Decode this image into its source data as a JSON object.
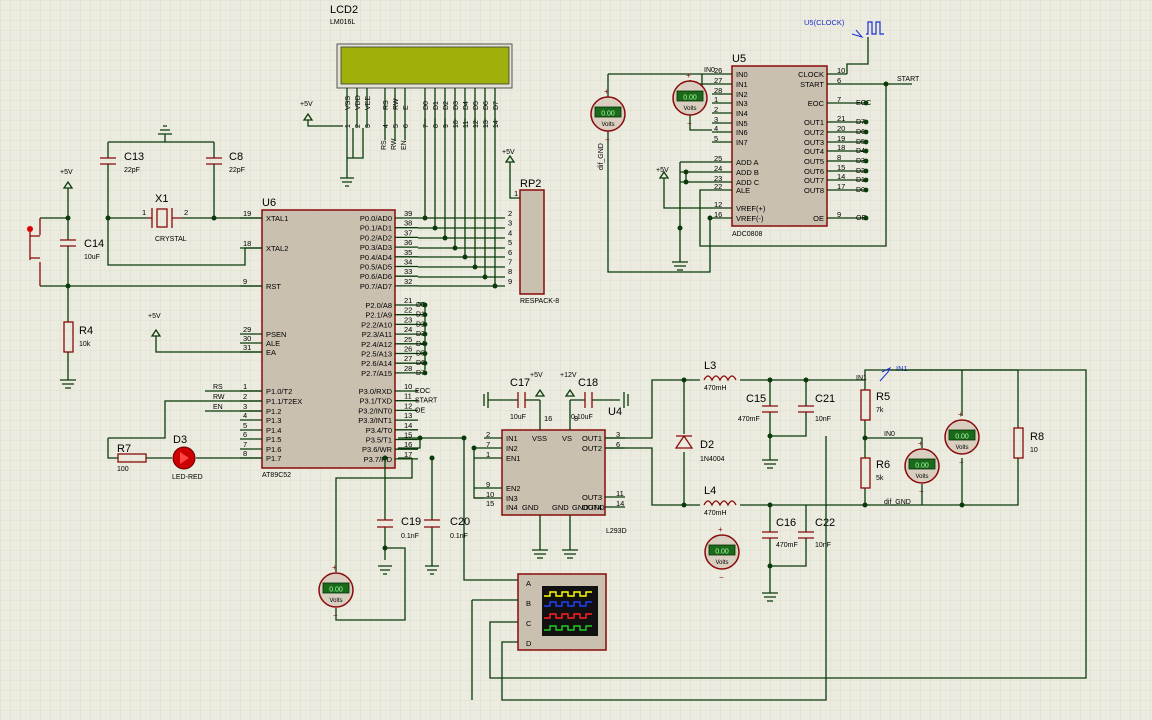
{
  "colors": {
    "background": "#ebebdf",
    "grid": "#d8d8c8",
    "wire": "#0a3a0a",
    "component": "#8a0a0a",
    "body": "#c9c0b0",
    "lcd": "#9fb00b",
    "meter": "#1a6a1a"
  },
  "lcd2": {
    "ref": "LCD2",
    "part": "LM016L",
    "pins": [
      "VSS",
      "VDD",
      "VEE",
      "RS",
      "RW",
      "E",
      "D0",
      "D1",
      "D2",
      "D3",
      "D4",
      "D5",
      "D6",
      "D7"
    ],
    "nums": [
      "1",
      "2",
      "3",
      "4",
      "5",
      "6",
      "7",
      "8",
      "9",
      "10",
      "11",
      "12",
      "13",
      "14"
    ],
    "rs": "RS",
    "rw": "RW",
    "en": "EN"
  },
  "u6": {
    "ref": "U6",
    "part": "AT89C52",
    "left": [
      {
        "n": "19",
        "l": "XTAL1"
      },
      {
        "n": "18",
        "l": "XTAL2"
      },
      {
        "n": "9",
        "l": "RST"
      },
      {
        "n": "29",
        "l": "PSEN"
      },
      {
        "n": "30",
        "l": "ALE"
      },
      {
        "n": "31",
        "l": "EA"
      },
      {
        "n": "1",
        "l": "P1.0/T2"
      },
      {
        "n": "2",
        "l": "P1.1/T2EX"
      },
      {
        "n": "3",
        "l": "P1.2"
      },
      {
        "n": "4",
        "l": "P1.3"
      },
      {
        "n": "5",
        "l": "P1.4"
      },
      {
        "n": "6",
        "l": "P1.5"
      },
      {
        "n": "7",
        "l": "P1.6"
      },
      {
        "n": "8",
        "l": "P1.7"
      }
    ],
    "p0": [
      {
        "n": "39",
        "l": "P0.0/AD0"
      },
      {
        "n": "38",
        "l": "P0.1/AD1"
      },
      {
        "n": "37",
        "l": "P0.2/AD2"
      },
      {
        "n": "36",
        "l": "P0.3/AD3"
      },
      {
        "n": "35",
        "l": "P0.4/AD4"
      },
      {
        "n": "34",
        "l": "P0.5/AD5"
      },
      {
        "n": "33",
        "l": "P0.6/AD6"
      },
      {
        "n": "32",
        "l": "P0.7/AD7"
      }
    ],
    "p2": [
      {
        "n": "21",
        "l": "P2.0/A8",
        "t": "D0"
      },
      {
        "n": "22",
        "l": "P2.1/A9",
        "t": "D1"
      },
      {
        "n": "23",
        "l": "P2.2/A10",
        "t": "D2"
      },
      {
        "n": "24",
        "l": "P2.3/A11",
        "t": "D3"
      },
      {
        "n": "25",
        "l": "P2.4/A12",
        "t": "D4"
      },
      {
        "n": "26",
        "l": "P2.5/A13",
        "t": "D5"
      },
      {
        "n": "27",
        "l": "P2.6/A14",
        "t": "D6"
      },
      {
        "n": "28",
        "l": "P2.7/A15",
        "t": "D7"
      }
    ],
    "p3": [
      {
        "n": "10",
        "l": "P3.0/RXD",
        "t": "EOC"
      },
      {
        "n": "11",
        "l": "P3.1/TXD",
        "t": "START"
      },
      {
        "n": "12",
        "l": "P3.2/INT0",
        "t": "OE"
      },
      {
        "n": "13",
        "l": "P3.3/INT1",
        "t": ""
      },
      {
        "n": "14",
        "l": "P3.4/T0",
        "t": ""
      },
      {
        "n": "15",
        "l": "P3.5/T1",
        "t": ""
      },
      {
        "n": "16",
        "l": "P3.6/WR",
        "t": ""
      },
      {
        "n": "17",
        "l": "P3.7/RD",
        "t": ""
      }
    ],
    "p1tags": [
      "RS",
      "RW",
      "EN"
    ]
  },
  "rp2": {
    "ref": "RP2",
    "part": "RESPACK-8",
    "pins": [
      "2",
      "3",
      "4",
      "5",
      "6",
      "7",
      "8",
      "9"
    ],
    "pin1": "1",
    "vcc": "+5V"
  },
  "u5": {
    "ref": "U5",
    "part": "ADC0808",
    "left": [
      {
        "n": "26",
        "l": "IN0"
      },
      {
        "n": "27",
        "l": "IN1"
      },
      {
        "n": "28",
        "l": "IN2"
      },
      {
        "n": "1",
        "l": "IN3"
      },
      {
        "n": "2",
        "l": "IN4"
      },
      {
        "n": "3",
        "l": "IN5"
      },
      {
        "n": "4",
        "l": "IN6"
      },
      {
        "n": "5",
        "l": "IN7"
      },
      {
        "n": "25",
        "l": "ADD A"
      },
      {
        "n": "24",
        "l": "ADD B"
      },
      {
        "n": "23",
        "l": "ADD C"
      },
      {
        "n": "22",
        "l": "ALE"
      },
      {
        "n": "12",
        "l": "VREF(+)"
      },
      {
        "n": "16",
        "l": "VREF(-)"
      }
    ],
    "right": [
      {
        "n": "10",
        "l": "CLOCK",
        "t": ""
      },
      {
        "n": "6",
        "l": "START",
        "t": ""
      },
      {
        "n": "7",
        "l": "EOC",
        "t": "EOC"
      },
      {
        "n": "21",
        "l": "OUT1",
        "t": "D7"
      },
      {
        "n": "20",
        "l": "OUT2",
        "t": "D6"
      },
      {
        "n": "19",
        "l": "OUT3",
        "t": "D5"
      },
      {
        "n": "18",
        "l": "OUT4",
        "t": "D4"
      },
      {
        "n": "8",
        "l": "OUT5",
        "t": "D3"
      },
      {
        "n": "15",
        "l": "OUT6",
        "t": "D2"
      },
      {
        "n": "14",
        "l": "OUT7",
        "t": "D1"
      },
      {
        "n": "17",
        "l": "OUT8",
        "t": "D0"
      },
      {
        "n": "9",
        "l": "OE",
        "t": "OE"
      }
    ],
    "in0": "IN0",
    "start": "START",
    "clock": "U5(CLOCK)"
  },
  "u4": {
    "ref": "U4",
    "part": "L293D",
    "left": [
      {
        "n": "2",
        "l": "IN1"
      },
      {
        "n": "7",
        "l": "IN2"
      },
      {
        "n": "1",
        "l": "EN1"
      },
      {
        "n": "9",
        "l": "EN2"
      },
      {
        "n": "10",
        "l": "IN3"
      },
      {
        "n": "15",
        "l": "IN4"
      }
    ],
    "right": [
      {
        "n": "3",
        "l": "OUT1"
      },
      {
        "n": "6",
        "l": "OUT2"
      },
      {
        "n": "11",
        "l": "OUT3"
      },
      {
        "n": "14",
        "l": "OUT4"
      }
    ],
    "top": [
      {
        "n": "16",
        "l": "VSS"
      },
      {
        "n": "8",
        "l": "VS"
      }
    ],
    "bottom": [
      "GND",
      "GND",
      "GND",
      "GND"
    ]
  },
  "x1": {
    "ref": "X1",
    "part": "CRYSTAL",
    "p1": "1",
    "p2": "2"
  },
  "c13": {
    "ref": "C13",
    "val": "22pF"
  },
  "c8": {
    "ref": "C8",
    "val": "22pF"
  },
  "c14": {
    "ref": "C14",
    "val": "10uF"
  },
  "r4": {
    "ref": "R4",
    "val": "10k"
  },
  "r7": {
    "ref": "R7",
    "val": "100"
  },
  "d3": {
    "ref": "D3",
    "val": "LED-RED"
  },
  "c17": {
    "ref": "C17",
    "val": "10uF"
  },
  "c18": {
    "ref": "C18",
    "val": "0.10uF"
  },
  "c19": {
    "ref": "C19",
    "val": "0.1nF"
  },
  "c20": {
    "ref": "C20",
    "val": "0.1nF"
  },
  "l3": {
    "ref": "L3",
    "val": "470mH"
  },
  "l4": {
    "ref": "L4",
    "val": "470mH"
  },
  "d2": {
    "ref": "D2",
    "val": "1N4004"
  },
  "c15": {
    "ref": "C15",
    "val": "470mF"
  },
  "c16": {
    "ref": "C16",
    "val": "470mF"
  },
  "c21": {
    "ref": "C21",
    "val": "10nF"
  },
  "c22": {
    "ref": "C22",
    "val": "10nF"
  },
  "r5": {
    "ref": "R5",
    "val": "7k"
  },
  "r6": {
    "ref": "R6",
    "val": "5k"
  },
  "r8": {
    "ref": "R8",
    "val": "10"
  },
  "power": {
    "p5v": "+5V",
    "p12v": "+12V"
  },
  "nets": {
    "in1": "IN1",
    "in0": "IN0",
    "dif_gnd": "dif_GND",
    "eoc": "EOC",
    "start": "START"
  },
  "voltmeter": {
    "reading": "0.00",
    "unit": "Volts"
  },
  "scope": {
    "channels": [
      "A",
      "B",
      "C",
      "D"
    ]
  }
}
